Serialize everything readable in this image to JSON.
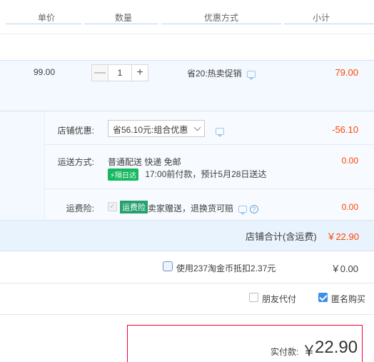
{
  "header": {
    "col_unit_price": "单价",
    "col_quantity": "数量",
    "col_discount": "优惠方式",
    "col_subtotal": "小计"
  },
  "item": {
    "unit_price": "99.00",
    "quantity": "1",
    "qty_minus": "—",
    "qty_plus": "+",
    "promo": "省20:热卖促销",
    "subtotal": "79.00"
  },
  "shop": {
    "discount_label": "店铺优惠:",
    "discount_select": "省56.10元:组合优惠",
    "discount_amount": "-56.10",
    "shipping_label": "运送方式:",
    "shipping_method": "普通配送 快递 免邮",
    "shipping_badge": "隔日达",
    "shipping_note": "17:00前付款，预计5月28日送达",
    "shipping_amount": "0.00",
    "insurance_label": "运费险:",
    "insurance_badge": "运费险",
    "insurance_text": "卖家赠送，退换货可赔",
    "insurance_amount": "0.00",
    "total_label": "店铺合计(含运费)",
    "total_value": "￥22.90"
  },
  "coins": {
    "text": "使用237淘金币抵扣2.37元",
    "amount": "￥0.00"
  },
  "options": {
    "friend_pay": "朋友代付",
    "anonymous": "匿名购买"
  },
  "payment": {
    "label": "实付款:",
    "currency": "￥",
    "amount": "22.90"
  },
  "colors": {
    "price_red": "#ff4400",
    "accent_blue": "#3d8ee8",
    "badge_green": "#13b85f",
    "pay_border": "#ff0036"
  }
}
